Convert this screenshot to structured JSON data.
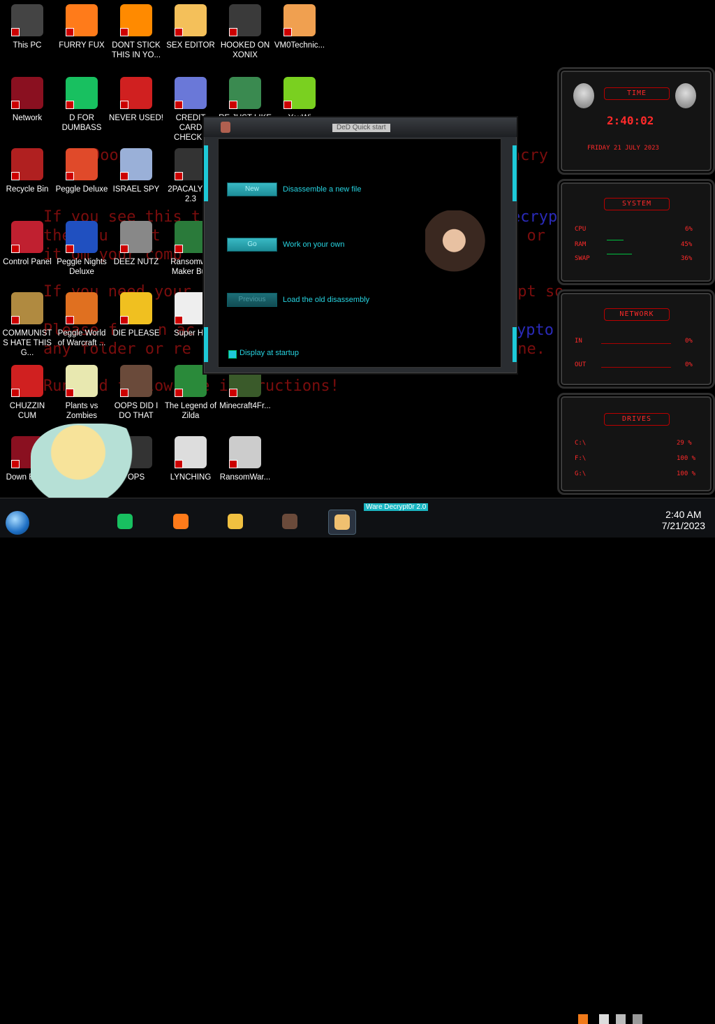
{
  "ransom_lines": [
    {
      "text": "Ooops, ",
      "color": "red"
    },
    {
      "text": "ncry",
      "color": "red"
    },
    {
      "text": "If you see this t",
      "color": "red"
    },
    {
      "text": "ecryp",
      "color": "blue"
    },
    {
      "text": "the you",
      "color": "red"
    },
    {
      "text": "unt",
      "color": "red"
    },
    {
      "text": "e or",
      "color": "red"
    },
    {
      "text": "it om your comp",
      "color": "red"
    },
    {
      "text": "If you need your",
      "color": "red"
    },
    {
      "text": "ypt so",
      "color": "red"
    },
    {
      "text": "Please f",
      "color": "red"
    },
    {
      "text": "n ac",
      "color": "red"
    },
    {
      "text": "ypto",
      "color": "blue"
    },
    {
      "text": "any folder or re",
      "color": "red"
    },
    {
      "text": "ine.",
      "color": "red"
    },
    {
      "text": "Run and follow the instructions!",
      "color": "red"
    }
  ],
  "desktop_icons": [
    {
      "label": "This PC",
      "icon": "computer-icon",
      "color": "#444"
    },
    {
      "label": "FURRY FUX",
      "icon": "firefox-icon",
      "color": "#ff7b1a"
    },
    {
      "label": "DONT STICK THIS IN YO...",
      "icon": "vlc-cone-icon",
      "color": "#ff8a00"
    },
    {
      "label": "SEX EDITOR",
      "icon": "hex-editor-icon",
      "color": "#f4c05a"
    },
    {
      "label": "HOOKED ON XONIX",
      "icon": "xonix-game-icon",
      "color": "#3a3a3a"
    },
    {
      "label": "VM0Technic...",
      "icon": "doctor-icon",
      "color": "#f0a050"
    },
    {
      "label": "Network",
      "icon": "alienware-network-icon",
      "color": "#8a1020"
    },
    {
      "label": "D FOR DUMBASS",
      "icon": "notes-app-icon",
      "color": "#18c060"
    },
    {
      "label": "NEVER USED!",
      "icon": "devcpp-icon",
      "color": "#d02020"
    },
    {
      "label": "CREDIT CARD CHECKE",
      "icon": "credit-card-icon",
      "color": "#6a78d8"
    },
    {
      "label": "RE JUST LIKE",
      "icon": "santa-elf-icon",
      "color": "#3a8a50"
    },
    {
      "label": "YouWi",
      "icon": "lime-slice-icon",
      "color": "#7ad020"
    },
    {
      "label": "Recycle Bin",
      "icon": "recycle-bin-icon",
      "color": "#b02020"
    },
    {
      "label": "Peggle Deluxe",
      "icon": "peggle-icon",
      "color": "#e04a2a"
    },
    {
      "label": "ISRAEL SPY",
      "icon": "spy-monitor-icon",
      "color": "#9ab0d8"
    },
    {
      "label": "2PACALYPS 2.3",
      "icon": "terminal-icon",
      "color": "#333"
    },
    {
      "label": "Control Panel",
      "icon": "control-panel-icon",
      "color": "#c02030"
    },
    {
      "label": "Peggle Nights Deluxe",
      "icon": "peggle-nights-icon",
      "color": "#2050c0"
    },
    {
      "label": "DEEZ NUTZ",
      "icon": "windows-stack-icon",
      "color": "#888"
    },
    {
      "label": "Ransomwa Maker Buil",
      "icon": "app-window-icon",
      "color": "#2a7a3a"
    },
    {
      "label": "COMMUNISTS HATE THIS G...",
      "icon": "money-bag-icon",
      "color": "#b08a40"
    },
    {
      "label": "Peggle World of Warcraft ...",
      "icon": "peggle-wow-icon",
      "color": "#e07020"
    },
    {
      "label": "DIE PLEASE",
      "icon": "de-logo-icon",
      "color": "#f0c020"
    },
    {
      "label": "Super Hit",
      "icon": "pixel-dog-icon",
      "color": "#eee"
    },
    {
      "label": "CHUZZIN CUM",
      "icon": "chuzzle-icon",
      "color": "#d02020"
    },
    {
      "label": "Plants vs Zombies",
      "icon": "flower-icon",
      "color": "#e8e8b0"
    },
    {
      "label": "OOPS DID I DO THAT",
      "icon": "lady-portrait-icon",
      "color": "#6a4a3a"
    },
    {
      "label": "The Legend of Zilda",
      "icon": "link-sprite-icon",
      "color": "#2a8a3a"
    },
    {
      "label": "Minecraft4Fr...",
      "icon": "minecraft-icon",
      "color": "#3a5a2a"
    },
    {
      "label": "Down Black",
      "icon": "alienware-download-icon",
      "color": "#8a1020"
    },
    {
      "label": "OPS",
      "icon": "book-icon",
      "color": "#333"
    },
    {
      "label": "LYNCHING",
      "icon": "noose-icon",
      "color": "#ddd"
    },
    {
      "label": "RansomWar...",
      "icon": "skull-ring-icon",
      "color": "#ccc"
    }
  ],
  "dialog": {
    "title": "DeD Quick start",
    "buttons": [
      {
        "label": "New",
        "text": "Disassemble a new file",
        "enabled": true
      },
      {
        "label": "Go",
        "text": "Work on your own",
        "enabled": true
      },
      {
        "label": "Previous",
        "text": "Load the old disassembly",
        "enabled": false
      }
    ],
    "checkbox_label": "Display at startup",
    "checkbox_checked": true
  },
  "widgets": {
    "time": {
      "header": "TIME",
      "time": "2:40:02",
      "date": "FRIDAY 21 JULY 2023"
    },
    "system": {
      "header": "SYSTEM",
      "rows": [
        {
          "label": "CPU",
          "value": "6%"
        },
        {
          "label": "RAM",
          "value": "45%"
        },
        {
          "label": "SWAP",
          "value": "36%"
        }
      ]
    },
    "network": {
      "header": "NETWORK",
      "rows": [
        {
          "label": "IN",
          "value": "0%"
        },
        {
          "label": "OUT",
          "value": "0%"
        }
      ]
    },
    "drives": {
      "header": "DRIVES",
      "rows": [
        {
          "label": "C:\\",
          "value": "29 %"
        },
        {
          "label": "F:\\",
          "value": "100 %"
        },
        {
          "label": "G:\\",
          "value": "100 %"
        }
      ]
    }
  },
  "taskbar": {
    "tooltip": "Ware Decrypt0r 2.0",
    "apps": [
      {
        "icon": "notes-app-icon",
        "color": "#18c060"
      },
      {
        "icon": "firefox-icon",
        "color": "#ff7b1a"
      },
      {
        "icon": "file-explorer-icon",
        "color": "#f0c040"
      },
      {
        "icon": "lady-portrait-icon",
        "color": "#6a4a3a"
      },
      {
        "icon": "handshake-icon",
        "color": "#f0c070"
      }
    ],
    "clock_time": "2:40 AM",
    "clock_date": "7/21/2023"
  }
}
